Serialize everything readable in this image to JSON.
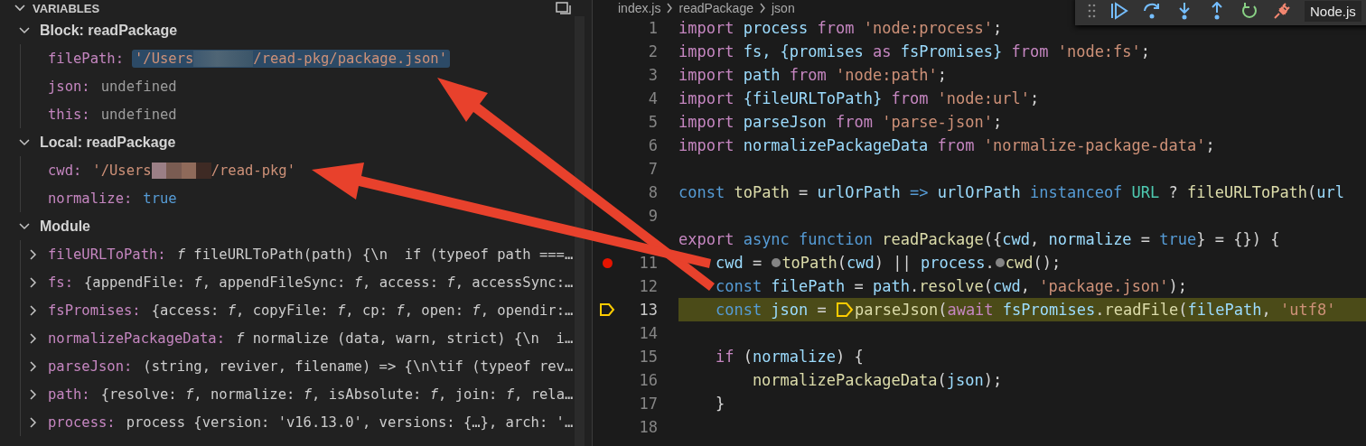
{
  "variables": {
    "title": "VARIABLES",
    "scopes": [
      {
        "label": "Block: readPackage",
        "expanded": true,
        "children": [
          {
            "name": "filePath:",
            "kind": "string",
            "value": "'/Users",
            "value_after": "/read-pkg/package.json'",
            "selected": true
          },
          {
            "name": "json:",
            "kind": "undefined",
            "value": "undefined",
            "selected": false
          },
          {
            "name": "this:",
            "kind": "undefined",
            "value": "undefined",
            "selected": false
          }
        ]
      },
      {
        "label": "Local: readPackage",
        "expanded": true,
        "children": [
          {
            "name": "cwd:",
            "kind": "string",
            "value": "'/Users",
            "value_after": "/read-pkg'",
            "selected": false
          },
          {
            "name": "normalize:",
            "kind": "boolean",
            "value": "true",
            "selected": false
          }
        ]
      },
      {
        "label": "Module",
        "expanded": true,
        "children": [
          {
            "name": "fileURLToPath:",
            "kind": "object",
            "value": "*f* fileURLToPath(path) {\\n  if (typeof path ===…",
            "selected": false
          },
          {
            "name": "fs:",
            "kind": "object",
            "value": "{appendFile: *f*, appendFileSync: *f*, access: *f*, accessSync:…",
            "selected": false
          },
          {
            "name": "fsPromises:",
            "kind": "object",
            "value": "{access: *f*, copyFile: *f*, cp: *f*, open: *f*, opendir:…",
            "selected": false
          },
          {
            "name": "normalizePackageData:",
            "kind": "object",
            "value": "*f* normalize (data, warn, strict) {\\n  i…",
            "selected": false
          },
          {
            "name": "parseJson:",
            "kind": "object",
            "value": "(string, reviver, filename) => {\\n\\tif (typeof rev…",
            "selected": false
          },
          {
            "name": "path:",
            "kind": "object",
            "value": "{resolve: *f*, normalize: *f*, isAbsolute: *f*, join: *f*, rela…",
            "selected": false
          },
          {
            "name": "process:",
            "kind": "object",
            "value": "process {version: 'v16.13.0', versions: {…}, arch: '…",
            "selected": false
          }
        ]
      }
    ]
  },
  "breadcrumb": [
    "index.js",
    "readPackage",
    "json"
  ],
  "debug_toolbar": {
    "target": "Node.js"
  },
  "editor": {
    "lines": [
      {
        "number": "1",
        "current": false,
        "tokens": [
          {
            "t": "import ",
            "kind": "keyword"
          },
          {
            "t": "process ",
            "kind": "variable"
          },
          {
            "t": "from ",
            "kind": "keyword"
          },
          {
            "t": "'node:process'",
            "kind": "string"
          },
          {
            "t": ";",
            "kind": "punctuation"
          }
        ]
      },
      {
        "number": "2",
        "current": false,
        "tokens": [
          {
            "t": "import ",
            "kind": "keyword"
          },
          {
            "t": "fs, {promises ",
            "kind": "variable"
          },
          {
            "t": "as ",
            "kind": "keyword"
          },
          {
            "t": "fsPromises} ",
            "kind": "variable"
          },
          {
            "t": "from ",
            "kind": "keyword"
          },
          {
            "t": "'node:fs'",
            "kind": "string"
          },
          {
            "t": ";",
            "kind": "punctuation"
          }
        ]
      },
      {
        "number": "3",
        "current": false,
        "tokens": [
          {
            "t": "import ",
            "kind": "keyword"
          },
          {
            "t": "path ",
            "kind": "variable"
          },
          {
            "t": "from ",
            "kind": "keyword"
          },
          {
            "t": "'node:path'",
            "kind": "string"
          },
          {
            "t": ";",
            "kind": "punctuation"
          }
        ]
      },
      {
        "number": "4",
        "current": false,
        "tokens": [
          {
            "t": "import ",
            "kind": "keyword"
          },
          {
            "t": "{fileURLToPath} ",
            "kind": "variable"
          },
          {
            "t": "from ",
            "kind": "keyword"
          },
          {
            "t": "'node:url'",
            "kind": "string"
          },
          {
            "t": ";",
            "kind": "punctuation"
          }
        ]
      },
      {
        "number": "5",
        "current": false,
        "tokens": [
          {
            "t": "import ",
            "kind": "keyword"
          },
          {
            "t": "parseJson ",
            "kind": "variable"
          },
          {
            "t": "from ",
            "kind": "keyword"
          },
          {
            "t": "'parse-json'",
            "kind": "string"
          },
          {
            "t": ";",
            "kind": "punctuation"
          }
        ]
      },
      {
        "number": "6",
        "current": false,
        "tokens": [
          {
            "t": "import ",
            "kind": "keyword"
          },
          {
            "t": "normalizePackageData ",
            "kind": "variable"
          },
          {
            "t": "from ",
            "kind": "keyword"
          },
          {
            "t": "'normalize-package-data'",
            "kind": "string"
          },
          {
            "t": ";",
            "kind": "punctuation"
          }
        ]
      },
      {
        "number": "7",
        "current": false
      },
      {
        "number": "8",
        "current": false,
        "tokens": [
          {
            "t": "const ",
            "kind": "storage"
          },
          {
            "t": "toPath",
            "kind": "function"
          },
          {
            "t": " = ",
            "kind": "punctuation"
          },
          {
            "t": "urlOrPath ",
            "kind": "variable"
          },
          {
            "t": "=> ",
            "kind": "storage"
          },
          {
            "t": "urlOrPath ",
            "kind": "variable"
          },
          {
            "t": "instanceof ",
            "kind": "storage"
          },
          {
            "t": "URL",
            "kind": "class"
          },
          {
            "t": " ? ",
            "kind": "punctuation"
          },
          {
            "t": "fileURLToPath",
            "kind": "function"
          },
          {
            "t": "(",
            "kind": "punctuation"
          },
          {
            "t": "url",
            "kind": "variable"
          }
        ]
      },
      {
        "number": "9",
        "current": false
      },
      {
        "current": false,
        "tokens": [
          {
            "t": "export ",
            "kind": "keyword"
          },
          {
            "t": "async ",
            "kind": "storage"
          },
          {
            "t": "function ",
            "kind": "storage"
          },
          {
            "t": "readPackage",
            "kind": "function"
          },
          {
            "t": "({",
            "kind": "punctuation"
          },
          {
            "t": "cwd",
            "kind": "variable"
          },
          {
            "t": ", ",
            "kind": "punctuation"
          },
          {
            "t": "normalize",
            "kind": "variable"
          },
          {
            "t": " = ",
            "kind": "punctuation"
          },
          {
            "t": "true",
            "kind": "storage"
          },
          {
            "t": "} = {}) {",
            "kind": "punctuation"
          }
        ]
      },
      {
        "number": "11",
        "current": false,
        "kind": "breakpoint",
        "tokens": [
          {
            "t": "    cwd",
            "kind": "variable"
          },
          {
            "t": " = ",
            "kind": "punctuation"
          },
          {
            "kind": "inline-breakpoint"
          },
          {
            "t": "toPath",
            "kind": "function"
          },
          {
            "t": "(",
            "kind": "punctuation"
          },
          {
            "t": "cwd",
            "kind": "variable"
          },
          {
            "t": ") || ",
            "kind": "punctuation"
          },
          {
            "t": "process",
            "kind": "variable"
          },
          {
            "t": ".",
            "kind": "punctuation"
          },
          {
            "kind": "inline-breakpoint"
          },
          {
            "t": "cwd",
            "kind": "function"
          },
          {
            "t": "();",
            "kind": "punctuation"
          }
        ]
      },
      {
        "number": "12",
        "current": false,
        "tokens": [
          {
            "t": "    const ",
            "kind": "storage"
          },
          {
            "t": "filePath",
            "kind": "variable"
          },
          {
            "t": " = ",
            "kind": "punctuation"
          },
          {
            "t": "path",
            "kind": "variable"
          },
          {
            "t": ".",
            "kind": "punctuation"
          },
          {
            "t": "resolve",
            "kind": "function"
          },
          {
            "t": "(",
            "kind": "punctuation"
          },
          {
            "t": "cwd",
            "kind": "variable"
          },
          {
            "t": ", ",
            "kind": "punctuation"
          },
          {
            "t": "'package.json'",
            "kind": "string"
          },
          {
            "t": ");",
            "kind": "punctuation"
          }
        ]
      },
      {
        "number": "13",
        "current": true,
        "kind": "paused",
        "tokens": [
          {
            "t": "    const ",
            "kind": "storage"
          },
          {
            "t": "json",
            "kind": "variable"
          },
          {
            "t": " = ",
            "kind": "punctuation"
          },
          {
            "kind": "stack-frame"
          },
          {
            "t": "parseJson",
            "kind": "function"
          },
          {
            "t": "(",
            "kind": "punctuation"
          },
          {
            "t": "await ",
            "kind": "keyword"
          },
          {
            "t": "fsPromises",
            "kind": "variable"
          },
          {
            "t": ".",
            "kind": "punctuation"
          },
          {
            "t": "readFile",
            "kind": "function"
          },
          {
            "t": "(",
            "kind": "punctuation"
          },
          {
            "t": "filePath",
            "kind": "variable"
          },
          {
            "t": ", ",
            "kind": "punctuation"
          },
          {
            "t": "'utf8'",
            "kind": "string"
          }
        ]
      },
      {
        "number": "14",
        "current": false
      },
      {
        "number": "15",
        "current": false,
        "tokens": [
          {
            "t": "    if",
            "kind": "keyword"
          },
          {
            "t": " (",
            "kind": "punctuation"
          },
          {
            "t": "normalize",
            "kind": "variable"
          },
          {
            "t": ") {",
            "kind": "punctuation"
          }
        ]
      },
      {
        "number": "16",
        "current": false,
        "tokens": [
          {
            "t": "        normalizePackageData",
            "kind": "function"
          },
          {
            "t": "(",
            "kind": "punctuation"
          },
          {
            "t": "json",
            "kind": "variable"
          },
          {
            "t": ");",
            "kind": "punctuation"
          }
        ]
      },
      {
        "number": "17",
        "current": false,
        "tokens": [
          {
            "t": "    }",
            "kind": "punctuation"
          }
        ]
      },
      {
        "number": "18",
        "current": false
      }
    ]
  }
}
